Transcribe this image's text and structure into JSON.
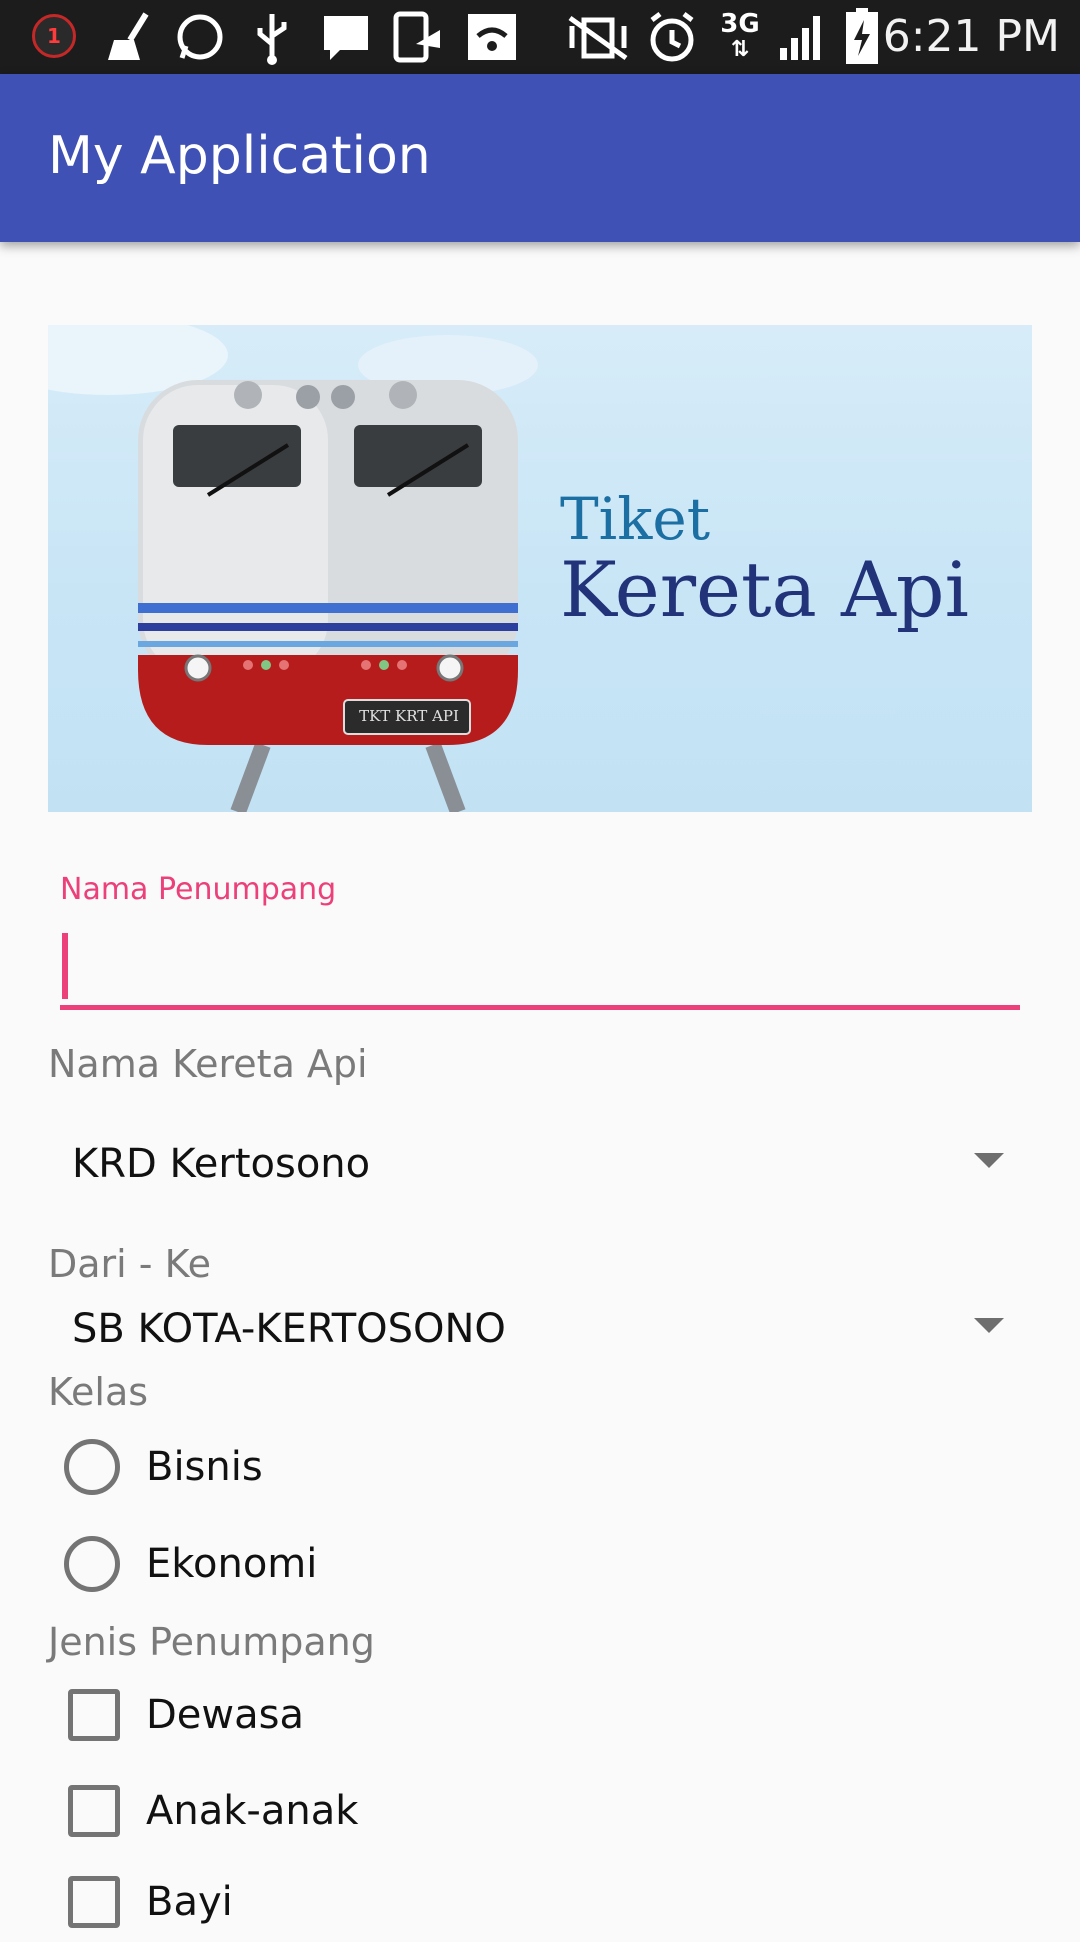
{
  "status_bar": {
    "notification_count": "1",
    "time": "6:21 PM",
    "network": "3G",
    "icons": [
      "broom-icon",
      "whatsapp-icon",
      "usb-icon",
      "bbm-icon",
      "share-icon",
      "wifi-icon",
      "vibrate-icon",
      "alarm-icon",
      "3g-icon",
      "signal-icon",
      "battery-charging-icon"
    ]
  },
  "app_bar": {
    "title": "My Application"
  },
  "banner": {
    "title_line1": "Tiket",
    "title_line2": "Kereta Api",
    "plate_text": "TKT KRT API"
  },
  "form": {
    "passenger_name": {
      "label": "Nama Penumpang",
      "value": ""
    },
    "train_name": {
      "label": "Nama Kereta Api",
      "selected": "KRD Kertosono"
    },
    "route": {
      "label": "Dari - Ke",
      "selected": "SB KOTA-KERTOSONO"
    },
    "class": {
      "label": "Kelas",
      "options": [
        {
          "label": "Bisnis",
          "checked": false
        },
        {
          "label": "Ekonomi",
          "checked": false
        }
      ]
    },
    "passenger_type": {
      "label": "Jenis Penumpang",
      "options": [
        {
          "label": "Dewasa",
          "checked": false
        },
        {
          "label": "Anak-anak",
          "checked": false
        },
        {
          "label": "Bayi",
          "checked": false
        }
      ]
    }
  },
  "colors": {
    "app_bar": "#3f51b5",
    "accent": "#ec407a",
    "status_bar": "#1c1c1c"
  }
}
